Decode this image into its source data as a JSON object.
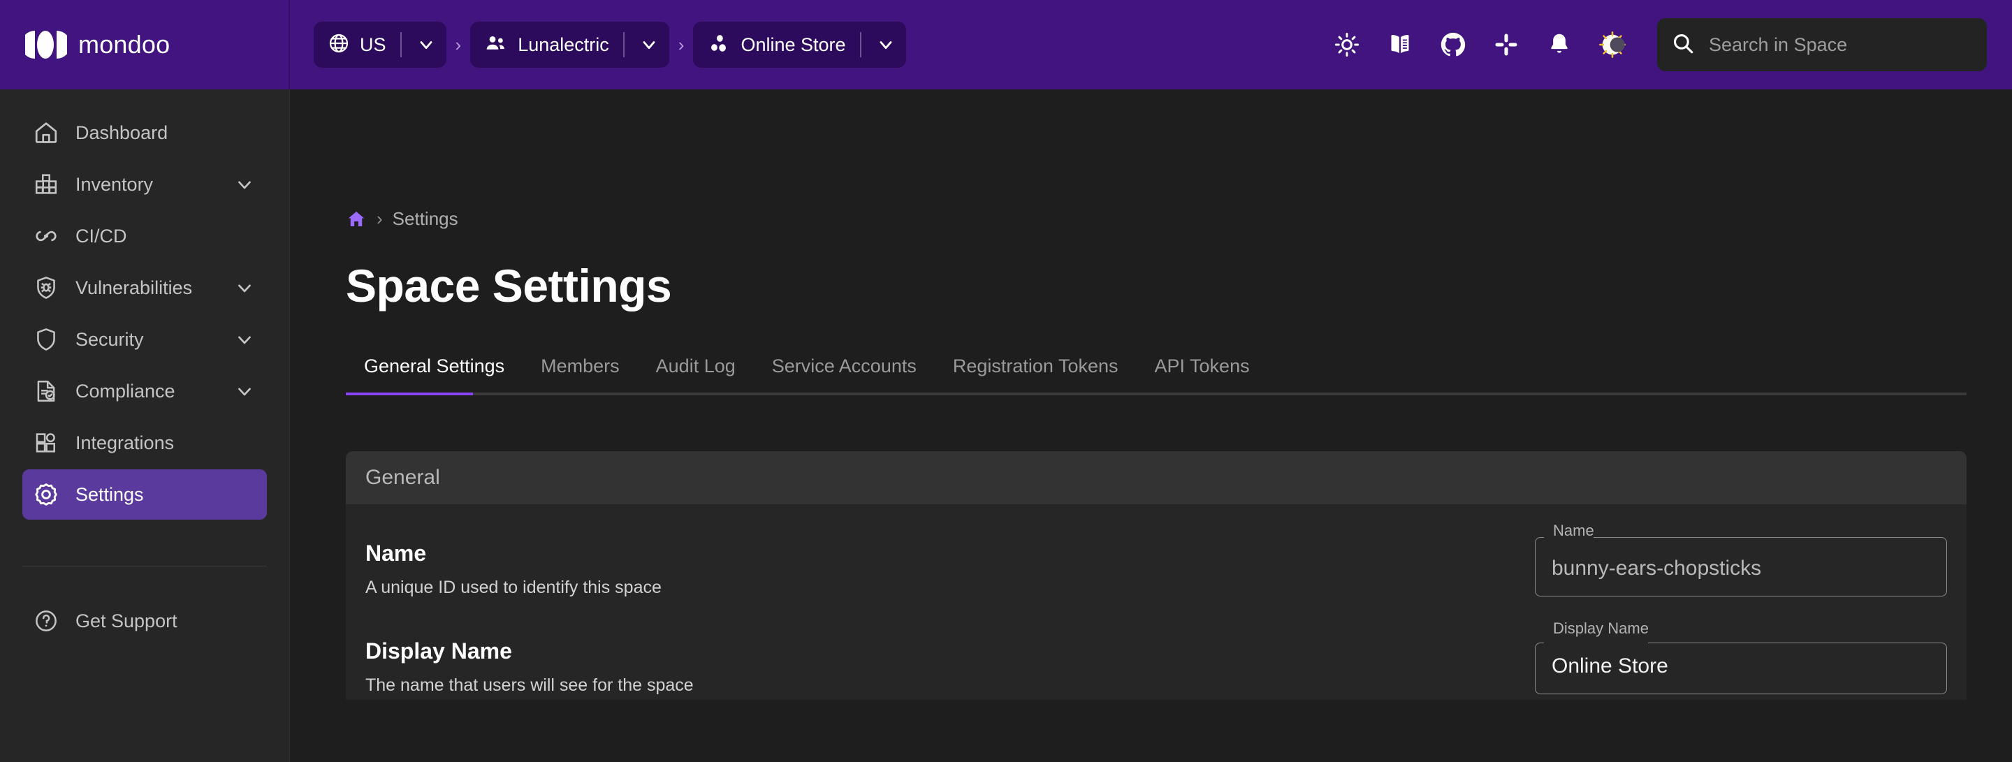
{
  "brand": {
    "name": "mondoo",
    "logo_icon": "mondoo-logo-icon"
  },
  "header": {
    "context": [
      {
        "icon": "globe-icon",
        "label": "US",
        "caret_icon": "chevron-down-icon"
      },
      {
        "icon": "organization-icon",
        "label": "Lunalectric",
        "caret_icon": "chevron-down-icon"
      },
      {
        "icon": "space-icon",
        "label": "Online Store",
        "caret_icon": "chevron-down-icon"
      }
    ],
    "separator": "›",
    "icons": [
      {
        "name": "brightness-icon",
        "title": "Brightness"
      },
      {
        "name": "docs-book-icon",
        "title": "Documentation"
      },
      {
        "name": "github-icon",
        "title": "GitHub"
      },
      {
        "name": "slack-icon",
        "title": "Slack"
      },
      {
        "name": "notifications-bell-icon",
        "title": "Notifications"
      },
      {
        "name": "theme-toggle-icon",
        "title": "Toggle theme"
      }
    ],
    "search": {
      "placeholder": "Search in Space",
      "icon": "search-icon"
    }
  },
  "sidebar": {
    "items": [
      {
        "label": "Dashboard",
        "icon": "home-icon",
        "expandable": false,
        "active": false
      },
      {
        "label": "Inventory",
        "icon": "inventory-blocks-icon",
        "expandable": true,
        "active": false
      },
      {
        "label": "CI/CD",
        "icon": "infinity-icon",
        "expandable": false,
        "active": false
      },
      {
        "label": "Vulnerabilities",
        "icon": "shield-bug-icon",
        "expandable": true,
        "active": false
      },
      {
        "label": "Security",
        "icon": "shield-icon",
        "expandable": true,
        "active": false
      },
      {
        "label": "Compliance",
        "icon": "document-check-icon",
        "expandable": true,
        "active": false
      },
      {
        "label": "Integrations",
        "icon": "integrations-icon",
        "expandable": false,
        "active": false
      },
      {
        "label": "Settings",
        "icon": "gear-icon",
        "expandable": false,
        "active": true
      }
    ],
    "support": {
      "label": "Get Support",
      "icon": "help-circle-icon"
    }
  },
  "main": {
    "breadcrumb": {
      "home_icon": "home-icon",
      "separator": "›",
      "current": "Settings"
    },
    "page_title": "Space Settings",
    "tabs": [
      {
        "label": "General Settings",
        "active": true
      },
      {
        "label": "Members",
        "active": false
      },
      {
        "label": "Audit Log",
        "active": false
      },
      {
        "label": "Service Accounts",
        "active": false
      },
      {
        "label": "Registration Tokens",
        "active": false
      },
      {
        "label": "API Tokens",
        "active": false
      }
    ],
    "card": {
      "title": "General",
      "rows": [
        {
          "title": "Name",
          "description": "A unique ID used to identify this space",
          "field_label": "Name",
          "field_value": "bunny-ears-chopsticks"
        },
        {
          "title": "Display Name",
          "description": "The name that users will see for the space",
          "field_label": "Display Name",
          "field_value": "Online Store"
        }
      ]
    }
  },
  "colors": {
    "header_purple": "#411480",
    "chip_purple": "#2c0a5c",
    "accent_purple": "#8b42ff",
    "sidebar_active": "#5b3a9e",
    "page_bg": "#1e1e1e",
    "sidebar_bg": "#262626",
    "card_header_bg": "#333333",
    "card_body_bg": "#262626"
  }
}
